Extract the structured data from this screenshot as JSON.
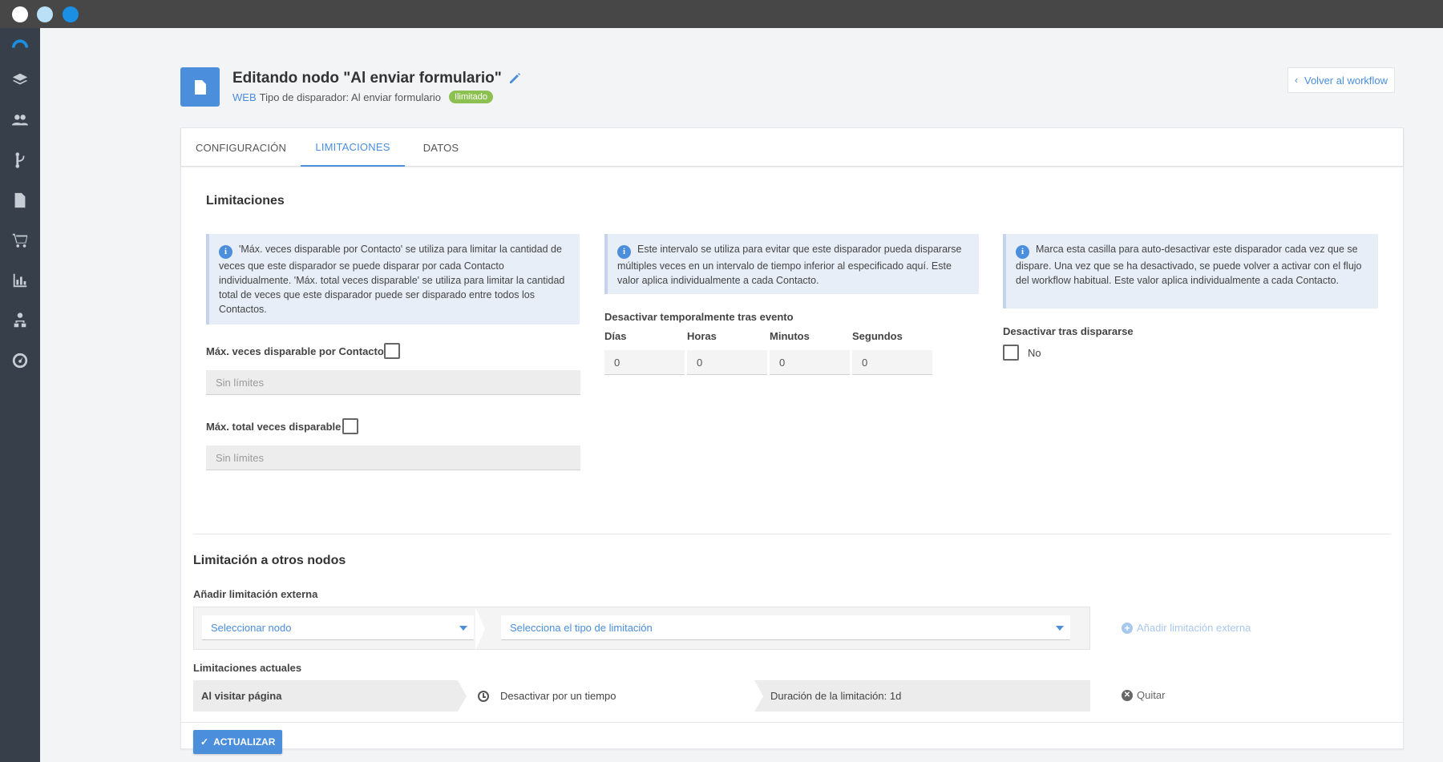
{
  "window": {
    "controls": [
      "close",
      "minimize",
      "maximize"
    ]
  },
  "sidebar": {
    "icons": [
      "logo-icon",
      "layers-icon",
      "contacts-icon",
      "workflow-icon",
      "document-icon",
      "cart-icon",
      "chart-icon",
      "sitemap-icon",
      "dashboard-icon"
    ]
  },
  "header": {
    "title": "Editando nodo \"Al enviar formulario\"",
    "web_label": "WEB",
    "subtitle": "Tipo de disparador: Al enviar formulario",
    "badge": "Ilimitado",
    "back_label": "Volver al workflow"
  },
  "tabs": [
    {
      "label": "CONFIGURACIÓN"
    },
    {
      "label": "LIMITACIONES"
    },
    {
      "label": "DATOS"
    }
  ],
  "limitations": {
    "title": "Limitaciones",
    "info1": "'Máx. veces disparable por Contacto' se utiliza para limitar la cantidad de veces que este disparador se puede disparar por cada Contacto individualmente. 'Máx. total veces disparable' se utiliza para limitar la cantidad total de veces que este disparador puede ser disparado entre todos los Contactos.",
    "info2": "Este intervalo se utiliza para evitar que este disparador pueda dispararse múltiples veces en un intervalo de tiempo inferior al especificado aquí. Este valor aplica individualmente a cada Contacto.",
    "info3": "Marca esta casilla para auto-desactivar este disparador cada vez que se dispare. Una vez que se ha desactivado, se puede volver a activar con el flujo del workflow habitual. Este valor aplica individualmente a cada Contacto.",
    "max_per_contact_label": "Máx. veces disparable por Contacto",
    "max_per_contact_placeholder": "Sin límites",
    "max_total_label": "Máx. total veces disparable",
    "max_total_placeholder": "Sin límites",
    "deactivate_temp_label": "Desactivar temporalmente tras evento",
    "time_fields": [
      {
        "label": "Días",
        "value": "0"
      },
      {
        "label": "Horas",
        "value": "0"
      },
      {
        "label": "Minutos",
        "value": "0"
      },
      {
        "label": "Segundos",
        "value": "0"
      }
    ],
    "deactivate_after_label": "Desactivar tras dispararse",
    "deactivate_after_value": "No"
  },
  "other_nodes": {
    "title": "Limitación a otros nodos",
    "add_label": "Añadir limitación externa",
    "select_node_placeholder": "Seleccionar nodo",
    "select_type_placeholder": "Selecciona el tipo de limitación",
    "add_button": "Añadir limitación externa",
    "current_label": "Limitaciones actuales",
    "current": {
      "node": "Al visitar página",
      "type": "Desactivar por un tiempo",
      "duration": "Duración de la limitación: 1d",
      "remove": "Quitar"
    }
  },
  "footer": {
    "update_button": "ACTUALIZAR"
  }
}
